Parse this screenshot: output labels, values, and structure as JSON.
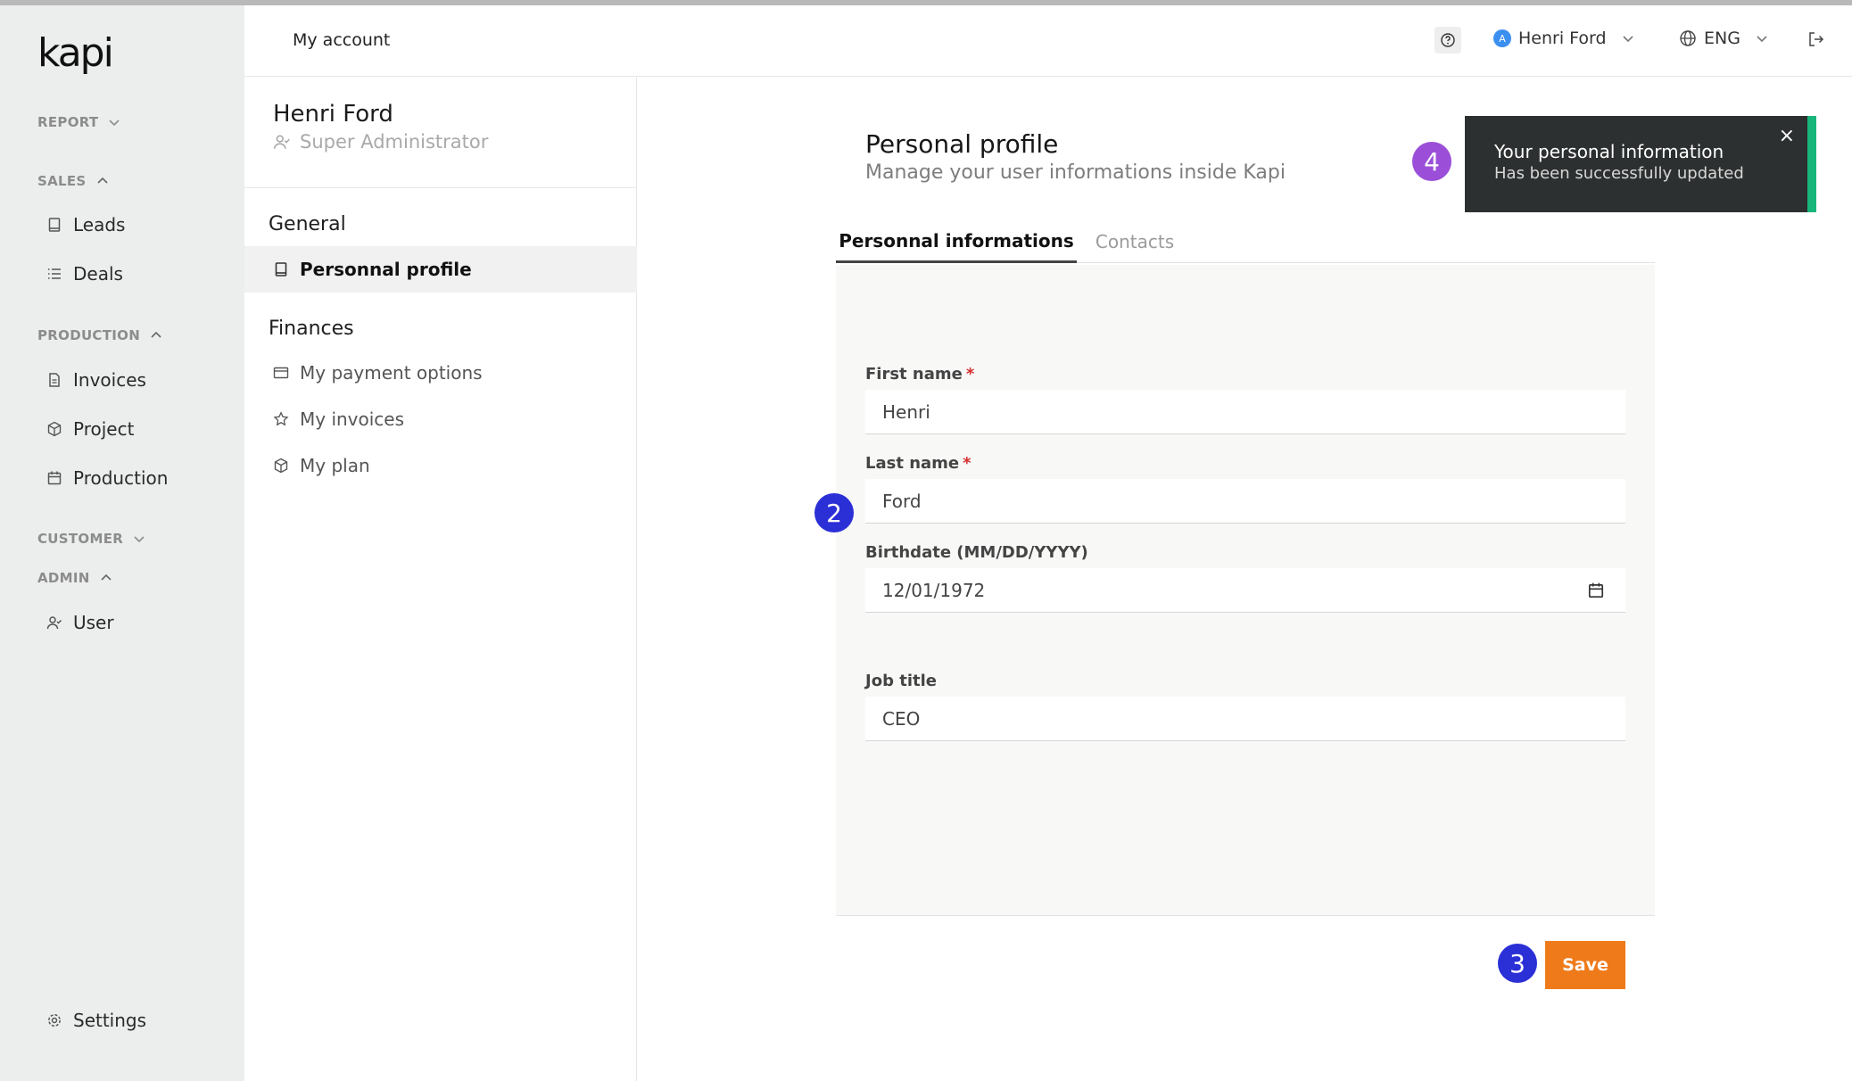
{
  "app": {
    "logo": "kapi"
  },
  "sidebar": {
    "sections": [
      {
        "label": "REPORT"
      },
      {
        "label": "SALES"
      },
      {
        "label": "PRODUCTION"
      },
      {
        "label": "CUSTOMER"
      },
      {
        "label": "ADMIN"
      }
    ],
    "items": [
      {
        "label": "Leads",
        "icon": "book-icon"
      },
      {
        "label": "Deals",
        "icon": "list-icon"
      },
      {
        "label": "Invoices",
        "icon": "document-icon"
      },
      {
        "label": "Project",
        "icon": "box-icon"
      },
      {
        "label": "Production",
        "icon": "calendar-icon"
      },
      {
        "label": "User",
        "icon": "user-check-icon"
      }
    ],
    "settings": "Settings"
  },
  "topbar": {
    "breadcrumb": "My account",
    "user": {
      "initial": "A",
      "name": "Henri Ford"
    },
    "language": "ENG"
  },
  "profile_panel": {
    "name": "Henri Ford",
    "role": "Super Administrator",
    "groups": [
      {
        "label": "General"
      },
      {
        "label": "Finances"
      }
    ],
    "items": [
      {
        "label": "Personnal profile",
        "active": true
      },
      {
        "label": "My payment options"
      },
      {
        "label": "My invoices"
      },
      {
        "label": "My plan"
      }
    ]
  },
  "main": {
    "title": "Personal profile",
    "subtitle": "Manage your user informations inside Kapi",
    "tabs": [
      {
        "label": "Personnal informations",
        "active": true
      },
      {
        "label": "Contacts"
      }
    ],
    "fields": {
      "first_name": {
        "label": "First name",
        "required_mark": "*",
        "value": "Henri"
      },
      "last_name": {
        "label": "Last name",
        "required_mark": "*",
        "value": "Ford"
      },
      "birthdate": {
        "label": "Birthdate (MM/DD/YYYY)",
        "value": "12/01/1972"
      },
      "job_title": {
        "label": "Job title",
        "value": "CEO"
      }
    },
    "save_label": "Save"
  },
  "markers": {
    "m2": "2",
    "m3": "3",
    "m4": "4"
  },
  "toast": {
    "title": "Your personal information",
    "message": "Has been successfully updated",
    "close": "×"
  },
  "colors": {
    "accent_orange": "#ef7a1a",
    "success_green": "#18b57a",
    "marker_blue": "#2b2fd6",
    "marker_purple": "#9b4fd8"
  }
}
